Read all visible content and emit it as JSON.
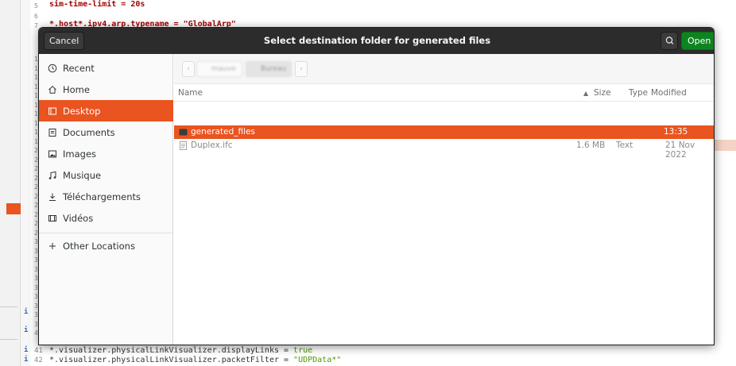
{
  "editor": {
    "top_lines": [
      {
        "num": "5",
        "text": "sim-time-limit = 20s"
      },
      {
        "num": "6",
        "text": ""
      },
      {
        "num": "7",
        "text": "*.host*.ipv4.arp.typename = \"GlobalArp\""
      }
    ],
    "gutter_nums": [
      "1",
      "1",
      "1",
      "1",
      "1",
      "1",
      "1",
      "1",
      "1",
      "1",
      "2",
      "2",
      "2",
      "2",
      "2",
      "2",
      "2",
      "2",
      "2",
      "2",
      "3",
      "3",
      "3",
      "3",
      "3",
      "3",
      "3",
      "3",
      "3",
      "3",
      "4"
    ],
    "bottom_lines": [
      {
        "num": "41",
        "key": "*.visualizer.physicalLinkVisualizer.displayLinks = ",
        "value": "true"
      },
      {
        "num": "42",
        "key": "*.visualizer.physicalLinkVisualizer.packetFilter = ",
        "value": "\"UDPData*\""
      }
    ],
    "info_marker": "i"
  },
  "dialog": {
    "title": "Select destination folder for generated files",
    "cancel_label": "Cancel",
    "open_label": "Open",
    "search_icon": "search-icon"
  },
  "sidebar": {
    "items": [
      {
        "label": "Recent",
        "icon": "clock-icon"
      },
      {
        "label": "Home",
        "icon": "home-icon"
      },
      {
        "label": "Desktop",
        "icon": "desktop-icon",
        "active": true
      },
      {
        "label": "Documents",
        "icon": "document-icon"
      },
      {
        "label": "Images",
        "icon": "image-icon"
      },
      {
        "label": "Musique",
        "icon": "music-icon"
      },
      {
        "label": "Téléchargements",
        "icon": "download-icon"
      },
      {
        "label": "Vidéos",
        "icon": "video-icon"
      }
    ],
    "other_locations": "Other Locations"
  },
  "pathbar": {
    "segments": [
      "mauve",
      "Bureau"
    ]
  },
  "columns": {
    "name": "Name",
    "size": "Size",
    "type": "Type",
    "modified": "Modified"
  },
  "files": [
    {
      "name": "generated_files",
      "size": "",
      "type": "",
      "modified": "13:35",
      "kind": "folder",
      "selected": true
    },
    {
      "name": "Duplex.ifc",
      "size": "1.6 MB",
      "type": "Text",
      "modified": "21 Nov 2022",
      "kind": "file",
      "selected": false
    }
  ],
  "colors": {
    "accent": "#e95420",
    "open_button": "#0e8420",
    "header": "#2c2c2c"
  }
}
